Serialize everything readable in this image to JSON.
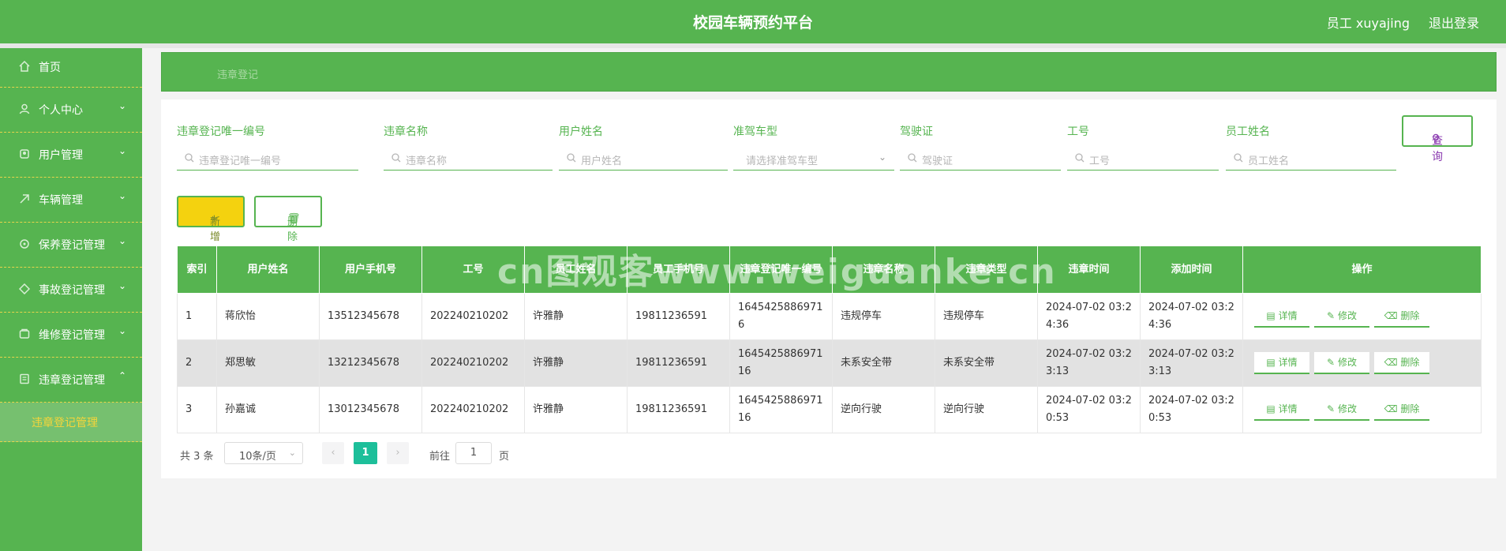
{
  "app": {
    "title": "校园车辆预约平台",
    "user": "员工 xuyajing",
    "logout": "退出登录"
  },
  "sidebar": {
    "items": [
      {
        "label": "首页",
        "icon": "home-icon"
      },
      {
        "label": "个人中心",
        "icon": "user-icon"
      },
      {
        "label": "用户管理",
        "icon": "users-icon"
      },
      {
        "label": "车辆管理",
        "icon": "car-icon"
      },
      {
        "label": "保养登记管理",
        "icon": "wrench-icon"
      },
      {
        "label": "事故登记管理",
        "icon": "alert-icon"
      },
      {
        "label": "维修登记管理",
        "icon": "tool-icon"
      },
      {
        "label": "违章登记管理",
        "icon": "ticket-icon"
      }
    ],
    "sub_item": "违章登记管理"
  },
  "breadcrumb": "违章登记",
  "filters": [
    {
      "label": "违章登记唯一编号",
      "placeholder": "违章登记唯一编号"
    },
    {
      "label": "违章名称",
      "placeholder": "违章名称"
    },
    {
      "label": "用户姓名",
      "placeholder": "用户姓名"
    },
    {
      "label": "准驾车型",
      "placeholder": "请选择准驾车型"
    },
    {
      "label": "驾驶证",
      "placeholder": "驾驶证"
    },
    {
      "label": "工号",
      "placeholder": "工号"
    },
    {
      "label": "员工姓名",
      "placeholder": "员工姓名"
    }
  ],
  "buttons": {
    "query": "查询",
    "add": "新增",
    "delete": "删除"
  },
  "table": {
    "headers": [
      "索引",
      "用户姓名",
      "用户手机号",
      "工号",
      "员工姓名",
      "员工手机号",
      "违章登记唯一编号",
      "违章名称",
      "违章类型",
      "违章时间",
      "添加时间",
      "操作"
    ],
    "rows": [
      [
        "1",
        "蒋欣怡",
        "13512345678",
        "202240210202",
        "许雅静",
        "19811236591",
        "16454258869716",
        "违规停车",
        "违规停车",
        "2024-07-02 03:24:36",
        "2024-07-02 03:24:36"
      ],
      [
        "2",
        "郑思敏",
        "13212345678",
        "202240210202",
        "许雅静",
        "19811236591",
        "164542588697116",
        "未系安全带",
        "未系安全带",
        "2024-07-02 03:23:13",
        "2024-07-02 03:23:13"
      ],
      [
        "3",
        "孙嘉诚",
        "13012345678",
        "202240210202",
        "许雅静",
        "19811236591",
        "164542588697116",
        "逆向行驶",
        "逆向行驶",
        "2024-07-02 03:20:53",
        "2024-07-02 03:20:53"
      ]
    ],
    "actions": [
      "详情",
      "修改",
      "删除"
    ]
  },
  "pagination": {
    "total": "共 3 条",
    "page_size": "10条/页",
    "current": "1",
    "goto_label": "前往",
    "goto_value": "1",
    "page_label": "页"
  },
  "watermark": "cn图观客www.weiguanke.cn",
  "colors": {
    "primary": "#56b450",
    "add_button": "#f4d20f",
    "active_page": "#1dbf9a",
    "submenu_text": "#f5d53a"
  }
}
